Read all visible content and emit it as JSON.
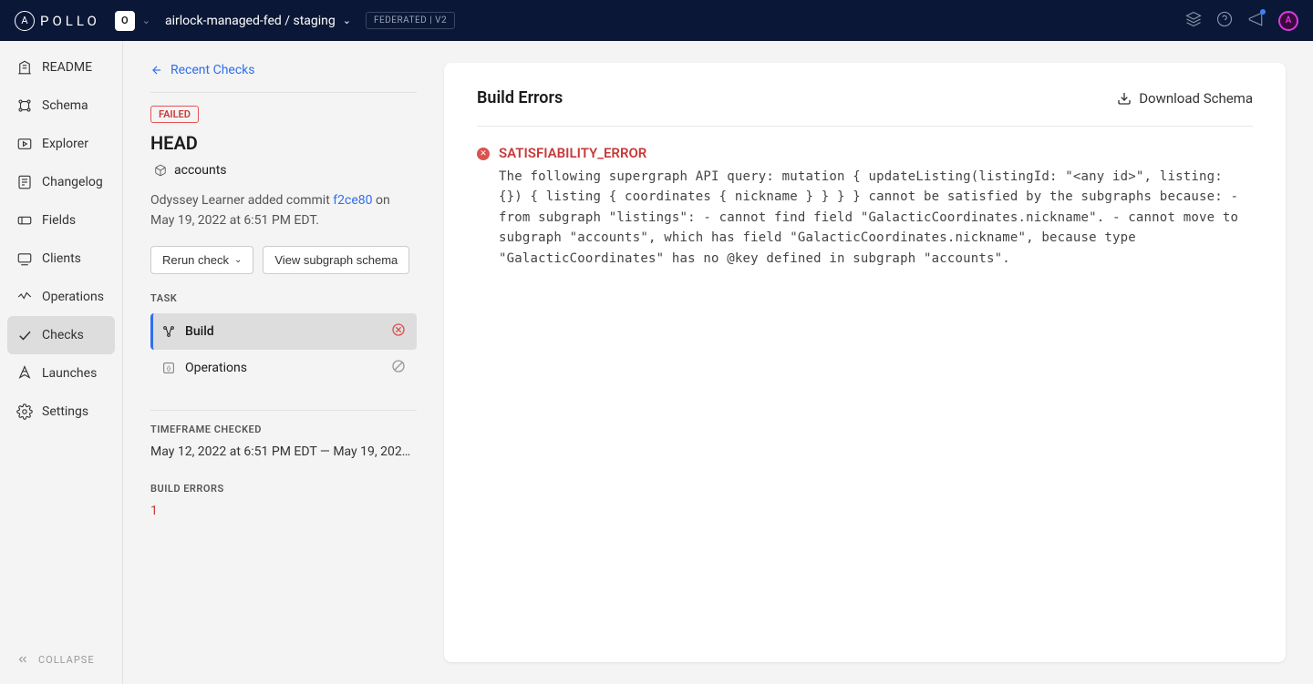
{
  "header": {
    "logo_text": "POLLO",
    "org_letter": "O",
    "graph_name": "airlock-managed-fed / staging",
    "fed_badge": "FEDERATED | V2",
    "avatar_letter": "A"
  },
  "sidebar": {
    "items": [
      {
        "label": "README"
      },
      {
        "label": "Schema"
      },
      {
        "label": "Explorer"
      },
      {
        "label": "Changelog"
      },
      {
        "label": "Fields"
      },
      {
        "label": "Clients"
      },
      {
        "label": "Operations"
      },
      {
        "label": "Checks"
      },
      {
        "label": "Launches"
      },
      {
        "label": "Settings"
      }
    ],
    "collapse": "COLLAPSE"
  },
  "left": {
    "back_link": "Recent Checks",
    "status": "FAILED",
    "title": "HEAD",
    "subgraph": "accounts",
    "commit_prefix": "Odyssey Learner added commit ",
    "commit_hash": "f2ce80",
    "commit_suffix": " on May 19, 2022 at 6:51 PM EDT.",
    "rerun_btn": "Rerun check",
    "view_schema_btn": "View subgraph schema",
    "task_label": "TASK",
    "tasks": [
      {
        "label": "Build"
      },
      {
        "label": "Operations"
      }
    ],
    "timeframe_label": "TIMEFRAME CHECKED",
    "timeframe_text": "May 12, 2022 at 6:51 PM EDT — May 19, 2022 at …",
    "build_errors_label": "BUILD ERRORS",
    "build_errors_count": "1"
  },
  "main": {
    "title": "Build Errors",
    "download": "Download Schema",
    "error_type": "SATISFIABILITY_ERROR",
    "error_message": "The following supergraph API query: mutation { updateListing(listingId: \"<any id>\", listing: {}) { listing { coordinates { nickname } } } } cannot be satisfied by the subgraphs because: - from subgraph \"listings\": - cannot find field \"GalacticCoordinates.nickname\". - cannot move to subgraph \"accounts\", which has field \"GalacticCoordinates.nickname\", because type \"GalacticCoordinates\" has no @key defined in subgraph \"accounts\"."
  }
}
